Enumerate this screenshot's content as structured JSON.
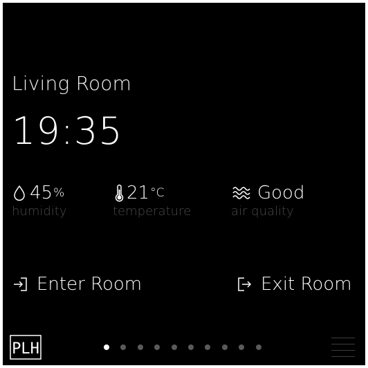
{
  "room": {
    "title": "Living Room",
    "time": "19:35"
  },
  "metrics": {
    "humidity": {
      "value": "45",
      "unit": "%",
      "caption": "humidity",
      "icon": "droplet-icon"
    },
    "temperature": {
      "value": "21",
      "unit": "°C",
      "caption": "temperature",
      "icon": "thermometer-icon"
    },
    "air_quality": {
      "value": "Good",
      "unit": "",
      "caption": "air quality",
      "icon": "air-waves-icon"
    }
  },
  "actions": {
    "enter_label": "Enter Room",
    "exit_label": "Exit Room"
  },
  "footer": {
    "logo_text": "PLH",
    "page_count": 10,
    "active_page": 1
  },
  "colors": {
    "background": "#000000",
    "text": "#ffffff",
    "caption": "#4a4a4a",
    "dot_inactive": "#5a5a5a",
    "dot_active": "#ffffff"
  }
}
